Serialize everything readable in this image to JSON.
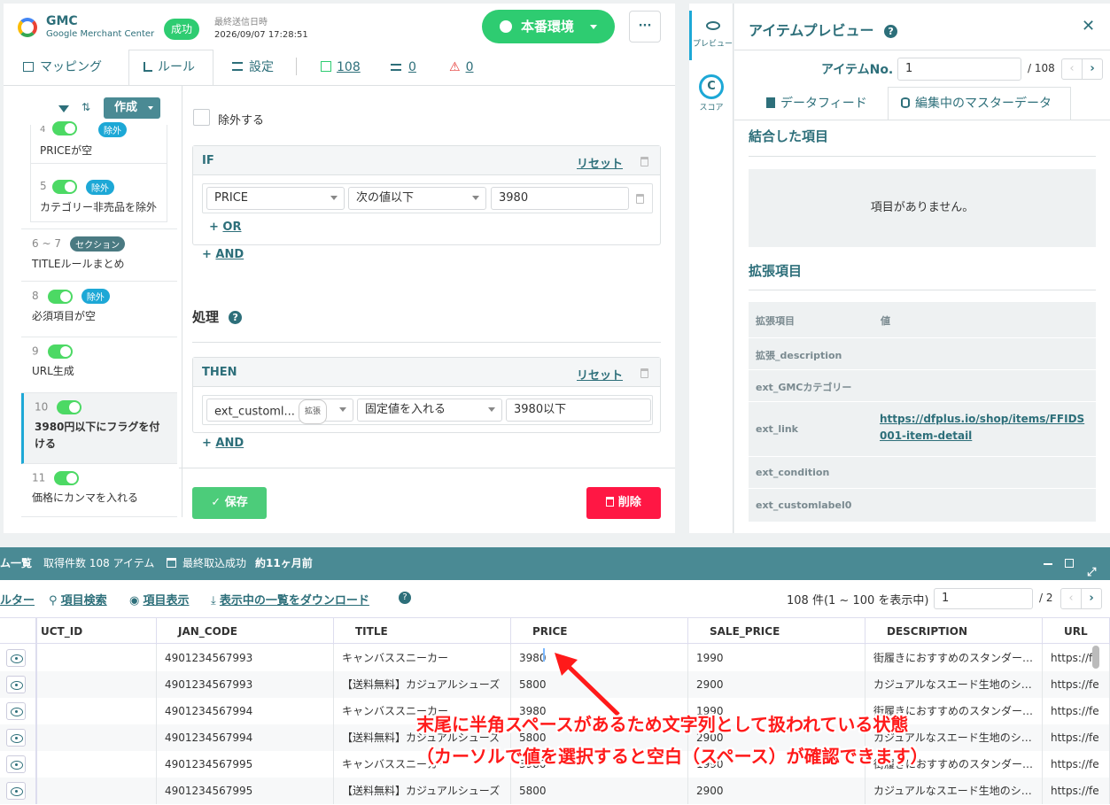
{
  "header": {
    "app_name": "GMC",
    "app_sub": "Google Merchant Center",
    "status_badge": "成功",
    "last_sent_label": "最終送信日時",
    "last_sent_value": "2026/09/07 17:28:51",
    "env_button": "本番環境",
    "more": "···",
    "tabs": [
      "マッピング",
      "ルール",
      "設定"
    ],
    "count_ok": "108",
    "count_x": "0",
    "count_warn": "0"
  },
  "rules_list": {
    "create_label": "作成",
    "items": [
      {
        "num": "4",
        "badge": "除外",
        "label": "PRICEが空"
      },
      {
        "num": "5",
        "badge": "除外",
        "label": "カテゴリー非売品を除外"
      },
      {
        "num": "6 ~ 7",
        "badge": "セクション",
        "label": "TITLEルールまとめ"
      },
      {
        "num": "8",
        "badge": "除外",
        "label": "必須項目が空"
      },
      {
        "num": "9",
        "badge": "",
        "label": "URL生成"
      },
      {
        "num": "10",
        "badge": "",
        "label": "3980円以下にフラグを付ける"
      },
      {
        "num": "11",
        "badge": "",
        "label": "価格にカンマを入れる"
      }
    ]
  },
  "rule_editor": {
    "exclude_label": "除外する",
    "if_label": "IF",
    "reset": "リセット",
    "cond_field": "PRICE",
    "cond_op": "次の値以下",
    "cond_value": "3980",
    "or_label": "OR",
    "and_label": "AND",
    "process_label": "処理",
    "then_label": "THEN",
    "then_field": "ext_customl...",
    "then_badge": "拡張",
    "then_op": "固定値を入れる",
    "then_value": "3980以下",
    "save": "保存",
    "delete": "削除"
  },
  "side_tabs": {
    "preview": "プレビュー",
    "score": "スコア"
  },
  "preview": {
    "title": "アイテムプレビュー",
    "item_no_label": "アイテムNo.",
    "item_no_value": "1",
    "item_total": "/ 108",
    "tab_feed": "データフィード",
    "tab_master": "編集中のマスターデータ",
    "joined_title": "結合した項目",
    "no_items": "項目がありません。",
    "ext_title": "拡張項目",
    "ext_head_key": "拡張項目",
    "ext_head_val": "値",
    "ext_rows": [
      {
        "k": "拡張_description",
        "v": ""
      },
      {
        "k": "ext_GMCカテゴリー",
        "v": ""
      },
      {
        "k": "ext_link",
        "v": "https://dfplus.io/shop/items/FFIDS001-item-detail"
      },
      {
        "k": "ext_condition",
        "v": ""
      },
      {
        "k": "ext_customlabel0",
        "v": ""
      }
    ]
  },
  "item_list": {
    "title": "ム一覧",
    "count_text": "取得件数 108 アイテム",
    "last_import": "最終取込成功",
    "last_import_ago": "約11ヶ月前",
    "filter": "ルター",
    "search": "項目検索",
    "display": "項目表示",
    "download": "表示中の一覧をダウンロード",
    "paging_text": "108 件(1 ~ 100 を表示中)",
    "page_value": "1",
    "page_total": "/ 2",
    "columns": [
      "UCT_ID",
      "JAN_CODE",
      "TITLE",
      "PRICE",
      "SALE_PRICE",
      "DESCRIPTION",
      "URL"
    ],
    "rows": [
      [
        "",
        "4901234567993",
        "キャンバススニーカー",
        "3980",
        "1990",
        "街履きにおすすめのスタンダー…",
        "https://fe"
      ],
      [
        "",
        "4901234567993",
        "【送料無料】カジュアルシューズ",
        "5800",
        "2900",
        "カジュアルなスエード生地のシ…",
        "https://fe"
      ],
      [
        "",
        "4901234567994",
        "キャンバススニーカー",
        "3980",
        "1990",
        "街履きにおすすめのスタンダー…",
        "https://fe"
      ],
      [
        "",
        "4901234567994",
        "【送料無料】カジュアルシューズ",
        "5800",
        "2900",
        "カジュアルなスエード生地のシ…",
        "https://fe"
      ],
      [
        "",
        "4901234567995",
        "キャンバススニーカー",
        "3980",
        "1990",
        "街履きにおすすめのスタンダー…",
        "https://fe"
      ],
      [
        "",
        "4901234567995",
        "【送料無料】カジュアルシューズ",
        "5800",
        "2900",
        "カジュアルなスエード生地のシ…",
        "https://fe"
      ]
    ]
  },
  "annotation": {
    "line1": "末尾に半角スペースがあるため文字列として扱われている状態",
    "line2": "（カーソルで値を選択すると空白（スペース）が確認できます）"
  },
  "colors": {
    "teal": "#4a8a94",
    "green": "#2ecc71",
    "red": "#ff1744",
    "accent": "#2d6f7a"
  }
}
